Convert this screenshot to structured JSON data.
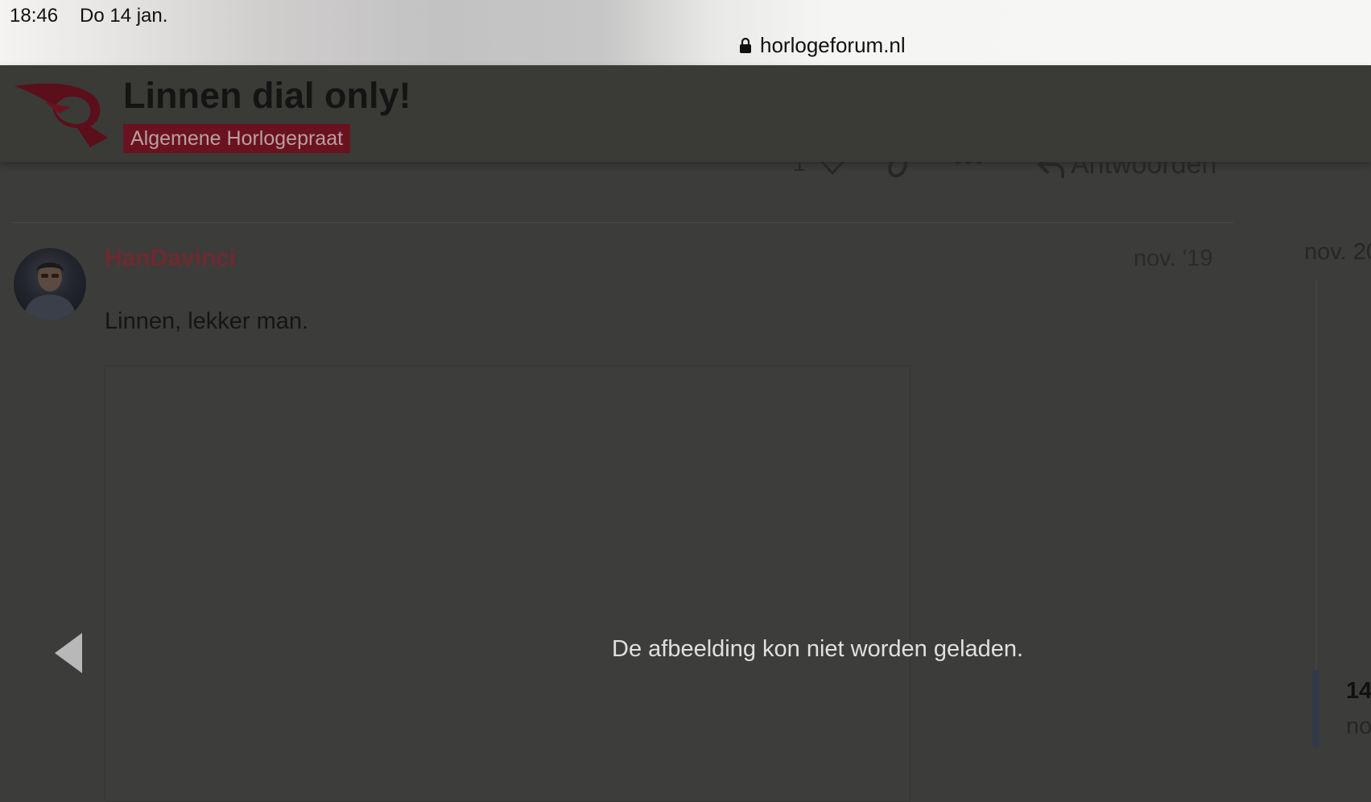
{
  "statusbar": {
    "time": "18:46",
    "date": "Do 14 jan.",
    "url": "horlogeforum.nl"
  },
  "header": {
    "title": "Linnen dial only!",
    "category": "Algemene Horlogepraat",
    "category_color": "#6b1220"
  },
  "post_controls": {
    "like_count": "1",
    "reply_label": "Antwoorden",
    "icons": [
      "heart-icon",
      "link-icon",
      "more-icon",
      "reply-icon"
    ]
  },
  "post": {
    "username": "HanDavinci",
    "date": "nov. '19",
    "text": "Linnen, lekker man.",
    "username_color": "#6e2a31"
  },
  "timeline": {
    "date": "nov. 20",
    "count": "14",
    "sub": "no"
  },
  "lightbox": {
    "error_message": "De afbeelding kon niet worden geladen."
  }
}
